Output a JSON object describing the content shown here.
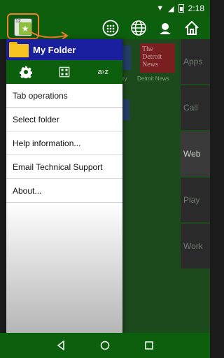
{
  "status_bar": {
    "time": "2:18",
    "wifi_icon": "wifi-icon",
    "signal_icon": "signal-icon",
    "battery_icon": "battery-icon"
  },
  "toolbar": {
    "app_icon": {
      "name": "app-launcher-icon",
      "number": "12"
    },
    "buttons": [
      {
        "name": "apps-grid-icon"
      },
      {
        "name": "globe-icon"
      },
      {
        "name": "user-icon"
      },
      {
        "name": "home-icon"
      }
    ]
  },
  "drawer": {
    "title": "My Folder",
    "tools": [
      {
        "name": "settings-icon"
      },
      {
        "name": "grid-view-icon"
      },
      {
        "name": "sort-az-icon",
        "label": "a›z"
      }
    ],
    "menu": [
      {
        "label": "Tab operations"
      },
      {
        "label": "Select folder"
      },
      {
        "label": "Help information..."
      },
      {
        "label": "Email Technical Support"
      },
      {
        "label": "About..."
      }
    ]
  },
  "background": {
    "tile_text": "The Detroit News",
    "tile_label": "Detroit News",
    "partial_label": "ry",
    "side_tabs": [
      {
        "label": "Apps",
        "active": false
      },
      {
        "label": "Call",
        "active": false
      },
      {
        "label": "Web",
        "active": true
      },
      {
        "label": "Play",
        "active": false
      },
      {
        "label": "Work",
        "active": false
      }
    ]
  },
  "nav_bar": {
    "back_icon": "back-icon",
    "home_icon": "home-circle-icon",
    "recents_icon": "recents-icon"
  },
  "colors": {
    "status_green": "#0d5d0d",
    "toolbar_green": "#0c5f0c",
    "drawer_header_blue": "#1a1f9e",
    "highlight_orange": "#f0802a"
  }
}
